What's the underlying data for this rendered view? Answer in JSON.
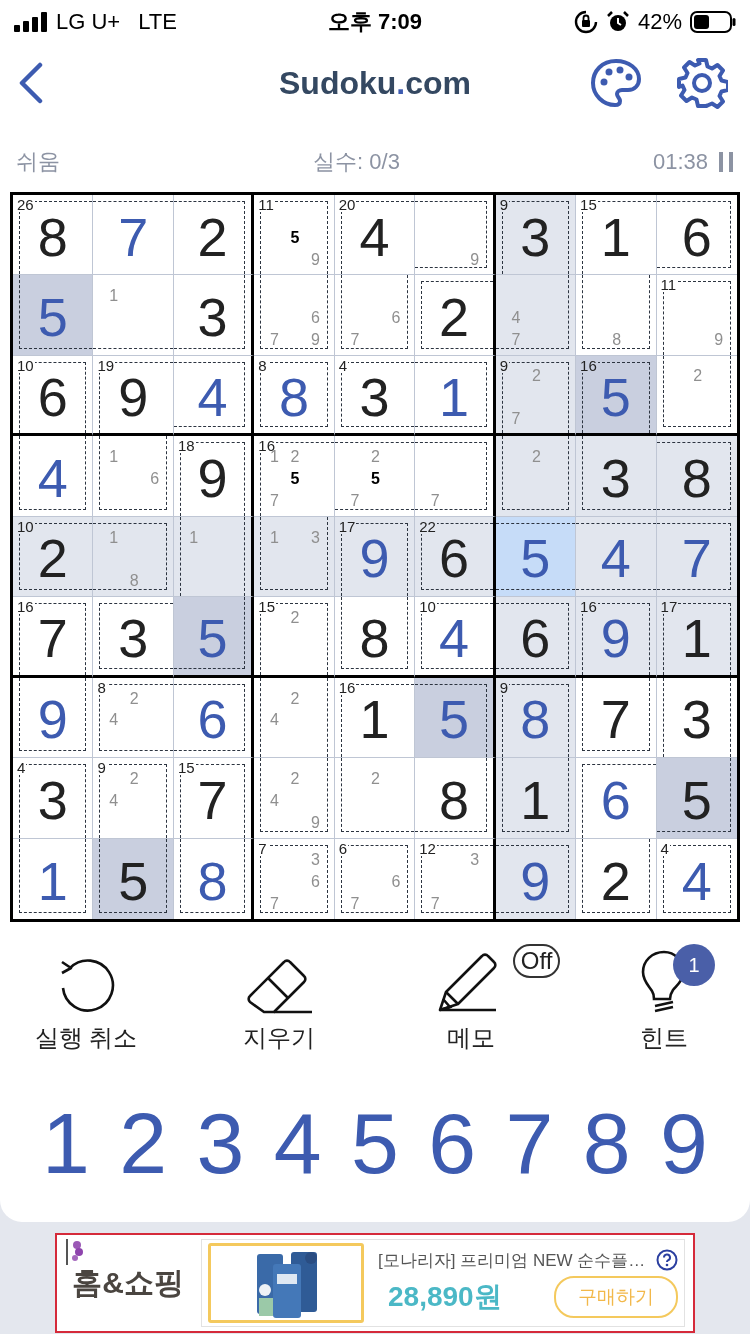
{
  "status_bar": {
    "carrier": "LG U+",
    "network": "LTE",
    "time": "오후 7:09",
    "battery": "42%"
  },
  "header": {
    "title": [
      "Sudoku",
      ".",
      "com"
    ]
  },
  "info": {
    "difficulty": "쉬움",
    "mistakes": "실수: 0/3",
    "timer": "01:38"
  },
  "board": {
    "rows": [
      [
        {
          "cage_sum": "26",
          "joins": {
            "right": true,
            "bottom": true
          },
          "value": "8",
          "kind": "given",
          "selected": false
        },
        {
          "joins": {
            "left": true,
            "right": true,
            "bottom": true
          },
          "value": "7",
          "kind": "entered",
          "selected": false
        },
        {
          "joins": {
            "left": true,
            "bottom": true
          },
          "value": "2",
          "kind": "given",
          "selected": false
        },
        {
          "cage_sum": "11",
          "joins": {
            "bottom": true
          },
          "notes": [
            "5",
            "9"
          ],
          "selected": false
        },
        {
          "cage_sum": "20",
          "joins": {
            "right": true,
            "bottom": true
          },
          "value": "4",
          "kind": "given",
          "selected": false
        },
        {
          "joins": {
            "left": true
          },
          "notes": [
            "9"
          ],
          "selected": false
        },
        {
          "cage_sum": "9",
          "joins": {
            "bottom": true
          },
          "value": "3",
          "kind": "given",
          "selected": false
        },
        {
          "cage_sum": "15",
          "joins": {
            "right": true,
            "bottom": true
          },
          "value": "1",
          "kind": "given",
          "selected": false
        },
        {
          "joins": {
            "left": true
          },
          "value": "6",
          "kind": "given",
          "selected": false
        }
      ],
      [
        {
          "joins": {
            "top": true,
            "right": true
          },
          "value": "5",
          "kind": "entered",
          "selected": false
        },
        {
          "joins": {
            "top": true,
            "left": true,
            "right": true
          },
          "notes": [
            "1"
          ],
          "selected": false
        },
        {
          "joins": {
            "top": true,
            "left": true
          },
          "value": "3",
          "kind": "given",
          "selected": false
        },
        {
          "joins": {
            "top": true
          },
          "notes": [
            "6",
            "7",
            "9"
          ],
          "selected": false
        },
        {
          "joins": {
            "top": true
          },
          "notes": [
            "6",
            "7"
          ],
          "selected": false
        },
        {
          "joins": {
            "right": true
          },
          "value": "2",
          "kind": "given",
          "selected": false
        },
        {
          "joins": {
            "top": true,
            "left": true
          },
          "notes": [
            "4",
            "7"
          ],
          "selected": false
        },
        {
          "joins": {
            "top": true
          },
          "notes": [
            "8"
          ],
          "selected": false
        },
        {
          "cage_sum": "11",
          "joins": {
            "bottom": true
          },
          "notes": [
            "9"
          ],
          "selected": false
        }
      ],
      [
        {
          "cage_sum": "10",
          "joins": {
            "bottom": true
          },
          "value": "6",
          "kind": "given",
          "selected": false
        },
        {
          "cage_sum": "19",
          "joins": {
            "right": true,
            "bottom": true
          },
          "value": "9",
          "kind": "given",
          "selected": false
        },
        {
          "joins": {
            "left": true
          },
          "value": "4",
          "kind": "entered",
          "selected": false
        },
        {
          "cage_sum": "8",
          "value": "8",
          "kind": "entered",
          "selected": false
        },
        {
          "cage_sum": "4",
          "joins": {
            "right": true
          },
          "value": "3",
          "kind": "given",
          "selected": false
        },
        {
          "joins": {
            "left": true
          },
          "value": "1",
          "kind": "entered",
          "selected": false
        },
        {
          "cage_sum": "9",
          "joins": {
            "bottom": true
          },
          "notes": [
            "2",
            "7"
          ],
          "selected": false
        },
        {
          "cage_sum": "16",
          "joins": {
            "bottom": true
          },
          "value": "5",
          "kind": "entered",
          "selected": false
        },
        {
          "joins": {
            "top": true
          },
          "notes": [
            "2"
          ],
          "selected": false
        }
      ],
      [
        {
          "joins": {
            "top": true
          },
          "value": "4",
          "kind": "entered",
          "selected": false
        },
        {
          "joins": {
            "top": true
          },
          "notes": [
            "1",
            "6"
          ],
          "selected": false
        },
        {
          "cage_sum": "18",
          "joins": {
            "bottom": true
          },
          "value": "9",
          "kind": "given",
          "selected": false
        },
        {
          "cage_sum": "16",
          "joins": {
            "right": true,
            "bottom": true
          },
          "notes": [
            "1",
            "2",
            "5",
            "7"
          ],
          "selected": false
        },
        {
          "joins": {
            "left": true,
            "right": true
          },
          "notes": [
            "2",
            "5",
            "7"
          ],
          "selected": false
        },
        {
          "joins": {
            "left": true
          },
          "notes": [
            "7"
          ],
          "selected": false
        },
        {
          "joins": {
            "top": true
          },
          "notes": [
            "2"
          ],
          "selected": false
        },
        {
          "joins": {
            "top": true,
            "right": true
          },
          "value": "3",
          "kind": "given",
          "selected": false
        },
        {
          "joins": {
            "left": true
          },
          "value": "8",
          "kind": "given",
          "selected": false
        }
      ],
      [
        {
          "cage_sum": "10",
          "joins": {
            "right": true
          },
          "value": "2",
          "kind": "given",
          "selected": false
        },
        {
          "joins": {
            "left": true
          },
          "notes": [
            "1",
            "8"
          ],
          "selected": false
        },
        {
          "joins": {
            "top": true,
            "bottom": true
          },
          "notes": [
            "1"
          ],
          "selected": false
        },
        {
          "joins": {
            "top": true
          },
          "notes": [
            "1",
            "3"
          ],
          "selected": false
        },
        {
          "cage_sum": "17",
          "joins": {
            "bottom": true
          },
          "value": "9",
          "kind": "entered",
          "selected": false
        },
        {
          "cage_sum": "22",
          "joins": {
            "right": true
          },
          "value": "6",
          "kind": "given",
          "selected": false
        },
        {
          "joins": {
            "left": true,
            "right": true
          },
          "value": "5",
          "kind": "entered",
          "selected": true
        },
        {
          "joins": {
            "left": true,
            "right": true
          },
          "value": "4",
          "kind": "entered",
          "selected": false
        },
        {
          "joins": {
            "left": true
          },
          "value": "7",
          "kind": "entered",
          "selected": false
        }
      ],
      [
        {
          "cage_sum": "16",
          "joins": {
            "bottom": true
          },
          "value": "7",
          "kind": "given",
          "selected": false
        },
        {
          "joins": {
            "right": true
          },
          "value": "3",
          "kind": "given",
          "selected": false
        },
        {
          "joins": {
            "top": true,
            "left": true
          },
          "value": "5",
          "kind": "entered",
          "selected": false
        },
        {
          "cage_sum": "15",
          "joins": {
            "bottom": true
          },
          "notes": [
            "2"
          ],
          "selected": false
        },
        {
          "joins": {
            "top": true
          },
          "value": "8",
          "kind": "given",
          "selected": false
        },
        {
          "cage_sum": "10",
          "joins": {
            "right": true
          },
          "value": "4",
          "kind": "entered",
          "selected": false
        },
        {
          "joins": {
            "left": true
          },
          "value": "6",
          "kind": "given",
          "selected": false
        },
        {
          "cage_sum": "16",
          "joins": {
            "bottom": true
          },
          "value": "9",
          "kind": "entered",
          "selected": false
        },
        {
          "cage_sum": "17",
          "joins": {
            "bottom": true
          },
          "value": "1",
          "kind": "given",
          "selected": false
        }
      ],
      [
        {
          "joins": {
            "top": true
          },
          "value": "9",
          "kind": "entered",
          "selected": false
        },
        {
          "cage_sum": "8",
          "joins": {
            "right": true
          },
          "notes": [
            "2",
            "4"
          ],
          "selected": false
        },
        {
          "joins": {
            "left": true
          },
          "value": "6",
          "kind": "entered",
          "selected": false
        },
        {
          "joins": {
            "top": true,
            "bottom": true
          },
          "notes": [
            "2",
            "4"
          ],
          "selected": false
        },
        {
          "cage_sum": "16",
          "joins": {
            "right": true,
            "bottom": true
          },
          "value": "1",
          "kind": "given",
          "selected": false
        },
        {
          "joins": {
            "left": true,
            "bottom": true
          },
          "value": "5",
          "kind": "entered",
          "selected": false
        },
        {
          "cage_sum": "9",
          "joins": {
            "bottom": true
          },
          "value": "8",
          "kind": "entered",
          "selected": false
        },
        {
          "joins": {
            "top": true
          },
          "value": "7",
          "kind": "given",
          "selected": false
        },
        {
          "joins": {
            "top": true,
            "bottom": true
          },
          "value": "3",
          "kind": "given",
          "selected": false
        }
      ],
      [
        {
          "cage_sum": "4",
          "joins": {
            "bottom": true
          },
          "value": "3",
          "kind": "given",
          "selected": false
        },
        {
          "cage_sum": "9",
          "joins": {
            "bottom": true
          },
          "notes": [
            "2",
            "4"
          ],
          "selected": false
        },
        {
          "cage_sum": "15",
          "joins": {
            "bottom": true
          },
          "value": "7",
          "kind": "given",
          "selected": false
        },
        {
          "joins": {
            "top": true
          },
          "notes": [
            "2",
            "4",
            "9"
          ],
          "selected": false
        },
        {
          "joins": {
            "top": true,
            "right": true
          },
          "notes": [
            "2"
          ],
          "selected": false
        },
        {
          "joins": {
            "top": true,
            "left": true
          },
          "value": "8",
          "kind": "given",
          "selected": false
        },
        {
          "joins": {
            "top": true
          },
          "value": "1",
          "kind": "given",
          "selected": false
        },
        {
          "joins": {
            "right": true,
            "bottom": true
          },
          "value": "6",
          "kind": "entered",
          "selected": false
        },
        {
          "joins": {
            "top": true,
            "left": true
          },
          "value": "5",
          "kind": "given",
          "selected": false
        }
      ],
      [
        {
          "joins": {
            "top": true
          },
          "value": "1",
          "kind": "entered",
          "selected": false
        },
        {
          "joins": {
            "top": true
          },
          "value": "5",
          "kind": "given",
          "selected": false
        },
        {
          "joins": {
            "top": true
          },
          "value": "8",
          "kind": "entered",
          "selected": false
        },
        {
          "cage_sum": "7",
          "notes": [
            "3",
            "6",
            "7"
          ],
          "selected": false
        },
        {
          "cage_sum": "6",
          "notes": [
            "6",
            "7"
          ],
          "selected": false
        },
        {
          "cage_sum": "12",
          "joins": {
            "right": true
          },
          "notes": [
            "3",
            "7"
          ],
          "selected": false
        },
        {
          "joins": {
            "left": true
          },
          "value": "9",
          "kind": "entered",
          "selected": false
        },
        {
          "joins": {
            "top": true
          },
          "value": "2",
          "kind": "given",
          "selected": false
        },
        {
          "cage_sum": "4",
          "value": "4",
          "kind": "entered",
          "selected": false
        }
      ]
    ]
  },
  "tools": [
    {
      "kind": "undo",
      "label": "실행 취소"
    },
    {
      "kind": "erase",
      "label": "지우기"
    },
    {
      "kind": "notes",
      "label": "메모",
      "badge": "Off"
    },
    {
      "kind": "hint",
      "label": "힌트",
      "badge": "1"
    }
  ],
  "number_pad": [
    "1",
    "2",
    "3",
    "4",
    "5",
    "6",
    "7",
    "8",
    "9"
  ],
  "ad": {
    "logo": "홈&쇼핑",
    "title": "[모나리자] 프리미엄 NEW 순수플…",
    "price": "28,890원",
    "button": "구매하기"
  }
}
